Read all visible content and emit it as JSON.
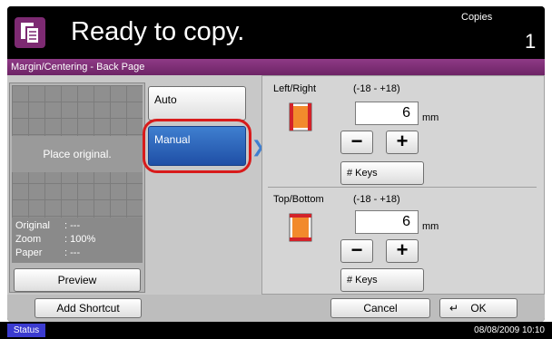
{
  "header": {
    "title": "Ready to copy.",
    "copies_label": "Copies",
    "copies_value": "1"
  },
  "breadcrumb": {
    "label": "Margin/Centering - Back Page"
  },
  "preview": {
    "place_text": "Place original.",
    "info": [
      {
        "label": "Original",
        "value": ": ---"
      },
      {
        "label": "Zoom",
        "value": ": 100%"
      },
      {
        "label": "Paper",
        "value": ": ---"
      }
    ],
    "preview_button": "Preview"
  },
  "modes": {
    "auto": "Auto",
    "manual": "Manual"
  },
  "left_right": {
    "label": "Left/Right",
    "range": "(-18 - +18)",
    "value": "6",
    "unit": "mm",
    "keys": "# Keys"
  },
  "top_bottom": {
    "label": "Top/Bottom",
    "range": "(-18 - +18)",
    "value": "6",
    "unit": "mm",
    "keys": "# Keys"
  },
  "footer": {
    "add_shortcut": "Add Shortcut",
    "cancel": "Cancel",
    "ok": "OK"
  },
  "statusbar": {
    "status": "Status",
    "datetime": "08/08/2009   10:10"
  },
  "colors": {
    "accent": "#7d2a72",
    "selected": "#2a5fb8",
    "highlight_ring": "#d81b1b"
  }
}
